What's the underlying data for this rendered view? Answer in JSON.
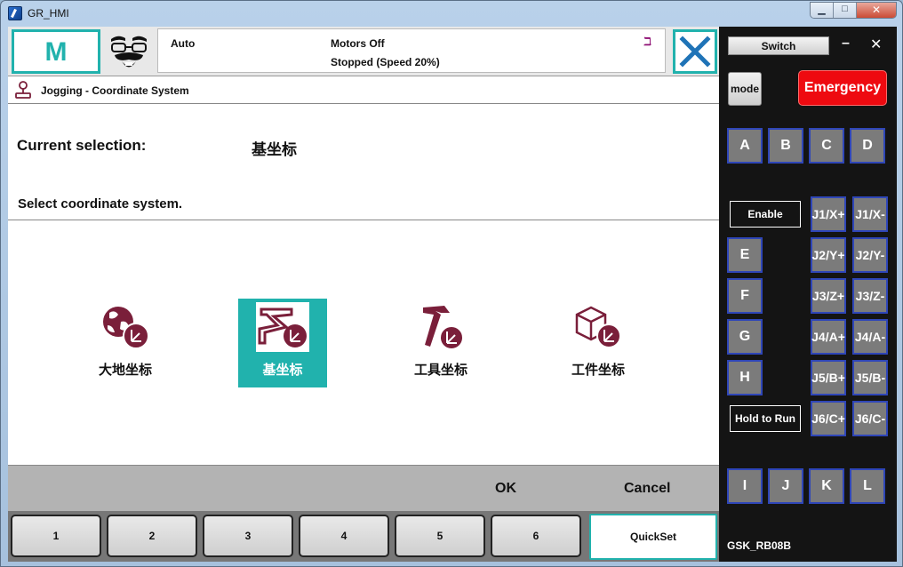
{
  "window": {
    "title": "GR_HMI",
    "min_icon": "minimize-icon",
    "max_icon": "maximize-icon",
    "close_icon": "close-icon"
  },
  "topbar": {
    "mode_letter": "M",
    "mode": "Auto",
    "motors": "Motors Off",
    "stopped": "Stopped (Speed 20%)",
    "close_icon": "x-icon"
  },
  "page": {
    "breadcrumb": "Jogging - Coordinate System",
    "current_label": "Current selection:",
    "current_value": "基坐标",
    "select_label": "Select coordinate system."
  },
  "options": [
    {
      "label": "大地坐标",
      "icon": "world-coordinate-icon",
      "selected": false
    },
    {
      "label": "基坐标",
      "icon": "base-coordinate-icon",
      "selected": true
    },
    {
      "label": "工具坐标",
      "icon": "tool-coordinate-icon",
      "selected": false
    },
    {
      "label": "工件坐标",
      "icon": "workpiece-coordinate-icon",
      "selected": false
    }
  ],
  "actions": {
    "ok": "OK",
    "cancel": "Cancel"
  },
  "tabs": [
    "1",
    "2",
    "3",
    "4",
    "5",
    "6"
  ],
  "quickset": "QuickSet",
  "right": {
    "switch": "Switch",
    "minimize": "–",
    "close": "✕",
    "mode": "mode",
    "emergency": "Emergency",
    "enable": "Enable",
    "hold": "Hold to Run",
    "top_keys": [
      "A",
      "B",
      "C",
      "D"
    ],
    "side_keys": [
      "E",
      "F",
      "G",
      "H"
    ],
    "bottom_keys": [
      "I",
      "J",
      "K",
      "L"
    ],
    "jog_plus": [
      "J1/X+",
      "J2/Y+",
      "J3/Z+",
      "J4/A+",
      "J5/B+",
      "J6/C+"
    ],
    "jog_minus": [
      "J1/X-",
      "J2/Y-",
      "J3/Z-",
      "J4/A-",
      "J5/B-",
      "J6/C-"
    ],
    "model": "GSK_RB08B"
  },
  "colors": {
    "accent": "#21b2ad",
    "icon": "#7a1f3a",
    "emergency": "#ee0a10",
    "key_border": "#2f46b8"
  }
}
